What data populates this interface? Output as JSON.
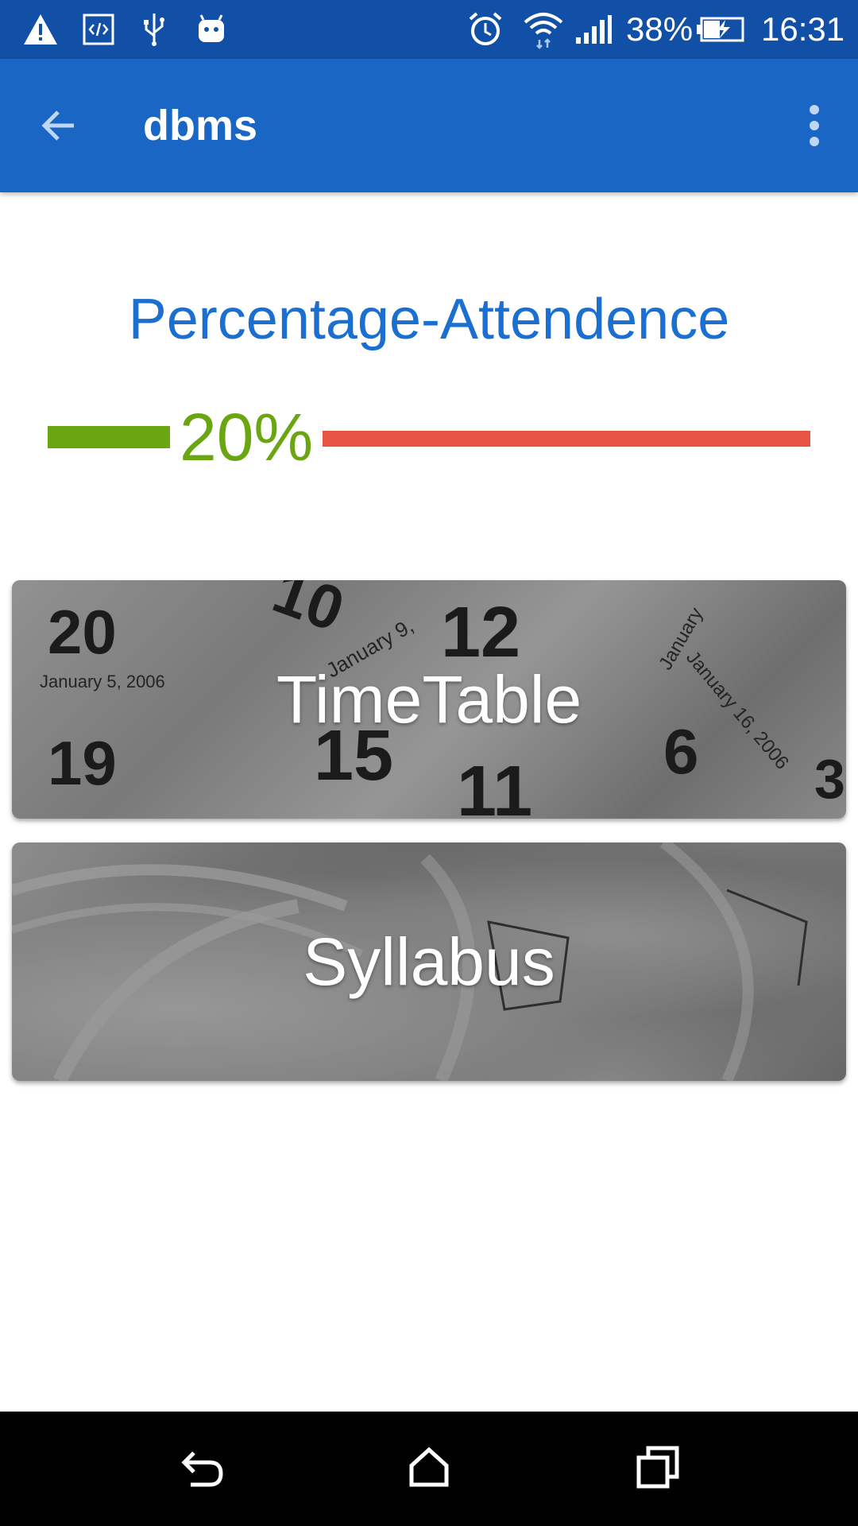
{
  "status_bar": {
    "battery_percent": "38%",
    "time": "16:31",
    "left_icons": [
      "warning-icon",
      "code-icon",
      "usb-icon",
      "android-icon"
    ],
    "right_icons": [
      "alarm-icon",
      "wifi-icon",
      "signal-icon",
      "battery-charging-icon"
    ],
    "bg_color": "#1150a6"
  },
  "app_bar": {
    "title": "dbms",
    "back_icon": "arrow-back-icon",
    "menu_icon": "more-vert-icon",
    "bg_color": "#1a66c4"
  },
  "attendance": {
    "heading": "Percentage-Attendence",
    "percent_label": "20%",
    "percent_value": 20,
    "colors": {
      "heading": "#1a6fd1",
      "attended": "#6aa611",
      "missed": "#e85443"
    }
  },
  "cards": {
    "timetable": {
      "label": "TimeTable",
      "background": "calendar-pages-photo"
    },
    "syllabus": {
      "label": "Syllabus",
      "background": "book-pages-photo"
    }
  },
  "nav_bar": {
    "buttons": [
      "back-nav-icon",
      "home-nav-icon",
      "recents-nav-icon"
    ]
  }
}
